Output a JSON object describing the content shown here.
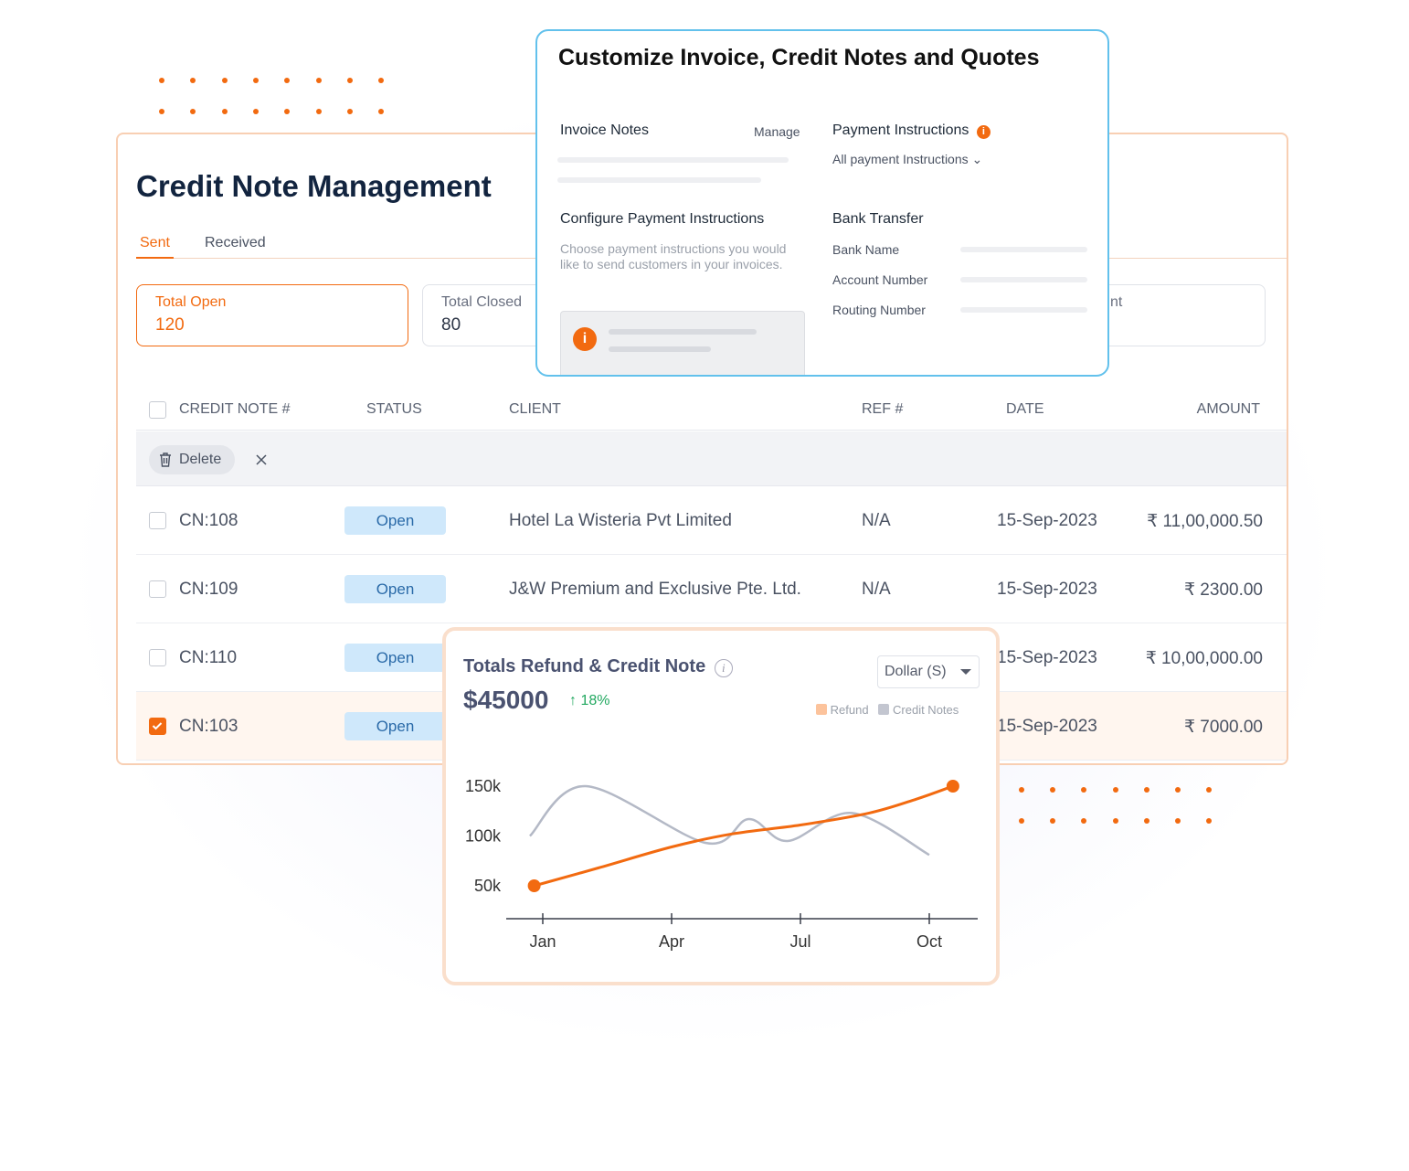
{
  "main": {
    "title": "Credit Note Management",
    "tabs": [
      {
        "label": "Sent",
        "active": true
      },
      {
        "label": "Received",
        "active": false
      }
    ],
    "stats": [
      {
        "label": "Total Open",
        "value": "120"
      },
      {
        "label": "Total Closed",
        "value": "80"
      },
      {
        "label": "nt",
        "value": ""
      }
    ],
    "columns": [
      "CREDIT NOTE #",
      "STATUS",
      "CLIENT",
      "REF #",
      "DATE",
      "AMOUNT"
    ],
    "bulk": {
      "delete_label": "Delete",
      "close_icon": "close-icon"
    },
    "rows": [
      {
        "id": "CN:108",
        "status": "Open",
        "client": "Hotel La Wisteria Pvt Limited",
        "ref": "N/A",
        "date": "15-Sep-2023",
        "amount": "₹ 11,00,000.50",
        "checked": false
      },
      {
        "id": "CN:109",
        "status": "Open",
        "client": "J&W Premium and Exclusive Pte. Ltd.",
        "ref": "N/A",
        "date": "15-Sep-2023",
        "amount": "₹ 2300.00",
        "checked": false
      },
      {
        "id": "CN:110",
        "status": "Open",
        "client": "",
        "ref": "",
        "date": "15-Sep-2023",
        "amount": "₹ 10,00,000.00",
        "checked": false
      },
      {
        "id": "CN:103",
        "status": "Open",
        "client": "",
        "ref": "",
        "date": "15-Sep-2023",
        "amount": "₹ 7000.00",
        "checked": true
      }
    ]
  },
  "popup": {
    "title": "Customize Invoice, Credit Notes and Quotes",
    "invoice_notes": "Invoice Notes",
    "manage": "Manage",
    "payment_instructions": "Payment Instructions",
    "all_payment": "All payment Instructions",
    "configure": "Configure Payment Instructions",
    "configure_desc": "Choose payment instructions you would like to send customers in your invoices.",
    "bank_transfer": "Bank Transfer",
    "bank_name": "Bank Name",
    "account_number": "Account Number",
    "routing_number": "Routing Number"
  },
  "chart_card": {
    "title": "Totals Refund & Credit Note",
    "total": "$45000",
    "change": "↑ 18%",
    "currency": "Dollar (S)"
  },
  "colors": {
    "accent": "#f26a10",
    "popup_border": "#62c1ec",
    "refund": "#f26a10",
    "credit_notes": "#b4b9c6",
    "positive": "#22a860"
  },
  "chart_data": {
    "type": "line",
    "x_unit": "month number (Jan=1)",
    "xticks": [
      {
        "x": 1,
        "label": "Jan"
      },
      {
        "x": 4,
        "label": "Apr"
      },
      {
        "x": 7,
        "label": "Jul"
      },
      {
        "x": 10,
        "label": "Oct"
      }
    ],
    "yticks": [
      {
        "y": 50,
        "label": "50k"
      },
      {
        "y": 100,
        "label": "100k"
      },
      {
        "y": 150,
        "label": "150k"
      }
    ],
    "ylim": [
      20,
      165
    ],
    "xlim": [
      0.2,
      11.3
    ],
    "grid": false,
    "legend": "top-right",
    "series": [
      {
        "name": "Refund",
        "color": "#f26a10",
        "smooth": true,
        "points": [
          [
            0.8,
            50
          ],
          [
            2.3,
            68
          ],
          [
            4,
            89
          ],
          [
            5.4,
            102
          ],
          [
            7,
            111
          ],
          [
            8.6,
            123
          ],
          [
            9.7,
            137
          ],
          [
            10.55,
            150
          ]
        ]
      },
      {
        "name": "Credit Notes",
        "color": "#b4b9c6",
        "points": [
          [
            0.7,
            100
          ],
          [
            2,
            150
          ],
          [
            4.8,
            93
          ],
          [
            5.8,
            117
          ],
          [
            6.7,
            95
          ],
          [
            8.2,
            123
          ],
          [
            10,
            81
          ]
        ]
      }
    ]
  }
}
